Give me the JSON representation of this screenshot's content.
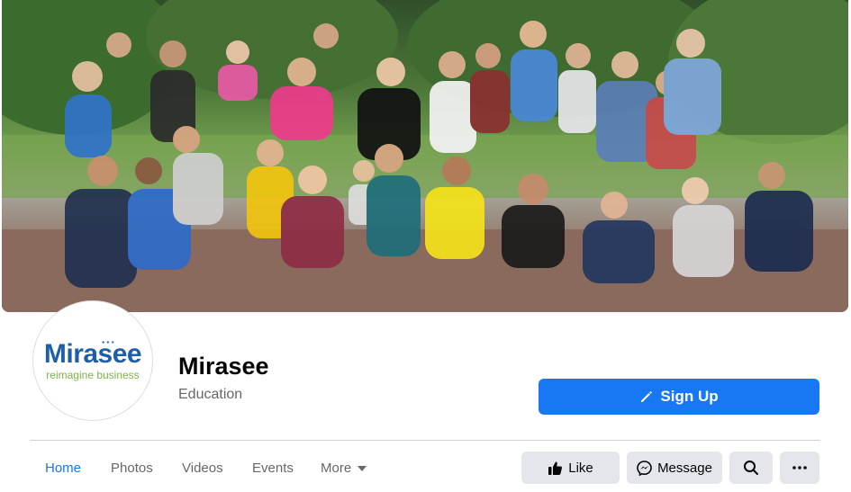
{
  "page": {
    "name": "Mirasee",
    "category": "Education"
  },
  "avatar": {
    "brand": "Mirasee",
    "tagline": "reimagine business"
  },
  "actions": {
    "signup_label": "Sign Up",
    "like_label": "Like",
    "message_label": "Message"
  },
  "tabs": [
    {
      "label": "Home"
    },
    {
      "label": "Photos"
    },
    {
      "label": "Videos"
    },
    {
      "label": "Events"
    },
    {
      "label": "More"
    }
  ],
  "colors": {
    "accent": "#1877f2",
    "secondary_button": "#e4e6eb",
    "brand_blue": "#1f5fa8",
    "brand_green": "#7cb342"
  },
  "icons": {
    "signup": "pencil-icon",
    "like": "thumbs-up-icon",
    "message": "messenger-icon",
    "search": "search-icon",
    "more_menu": "ellipsis-icon",
    "more_tab": "caret-down-icon"
  }
}
